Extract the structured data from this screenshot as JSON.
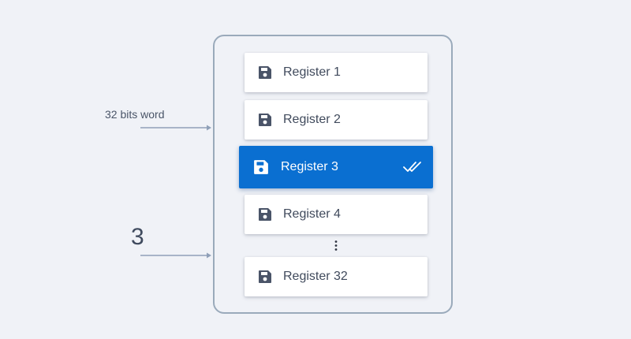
{
  "inputs": {
    "word_label": "32 bits word",
    "index_label": "3"
  },
  "registers": [
    {
      "label": "Register 1",
      "selected": false
    },
    {
      "label": "Register 2",
      "selected": false
    },
    {
      "label": "Register 3",
      "selected": true
    },
    {
      "label": "Register 4",
      "selected": false
    },
    {
      "label": "Register 32",
      "selected": false
    }
  ],
  "icons": {
    "register": "save-icon",
    "selected_marker": "double-check-icon",
    "gap": "vertical-ellipsis-icon",
    "input": "arrow-right-icon"
  },
  "colors": {
    "background": "#f0f2f7",
    "selected": "#0a6fd1",
    "card": "#ffffff",
    "text": "#404a5c",
    "outline": "#9aaabb",
    "arrow": "#8fa0b8"
  }
}
